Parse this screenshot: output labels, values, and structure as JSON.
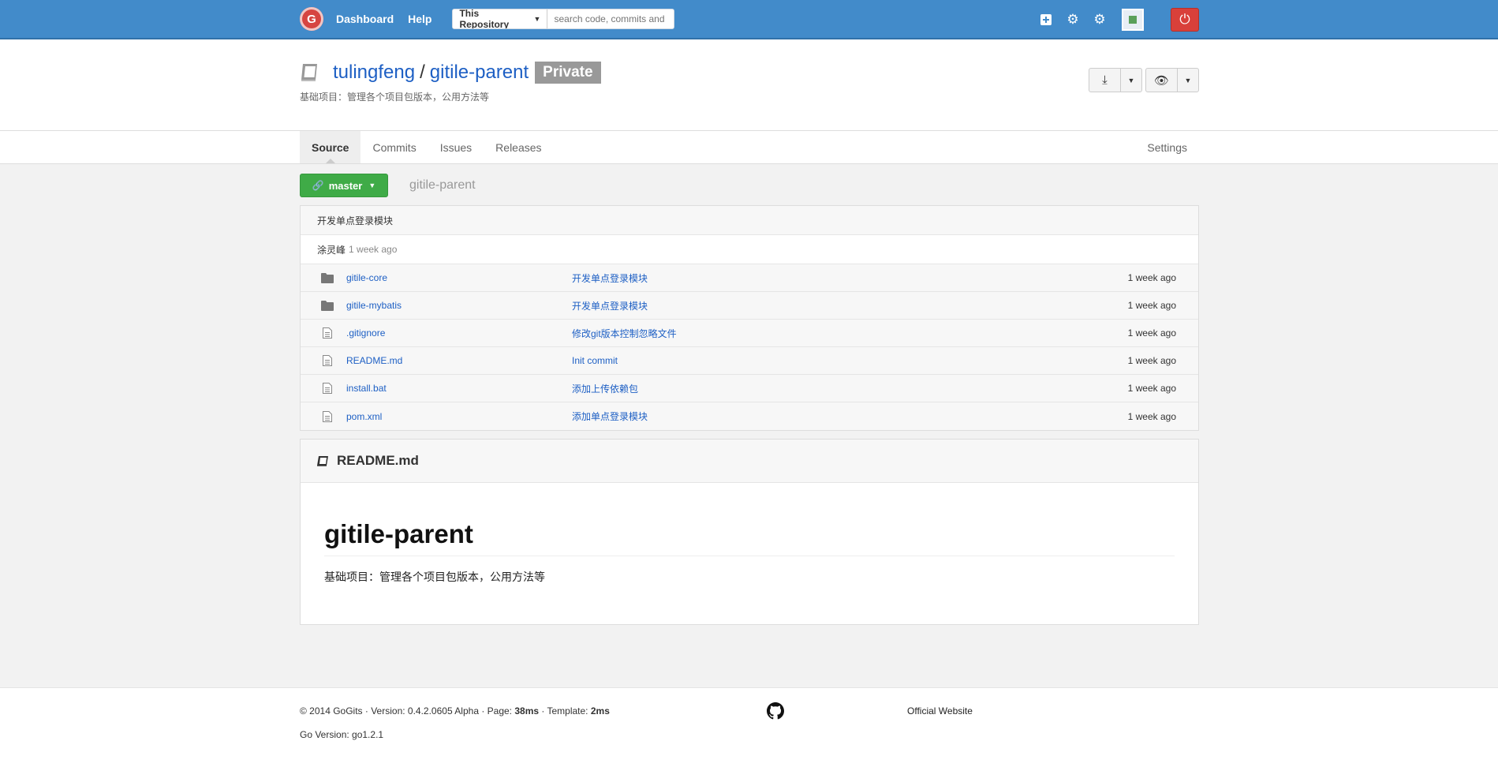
{
  "nav": {
    "logo_text": "G",
    "dashboard": "Dashboard",
    "help": "Help",
    "search_scope": "This Repository",
    "search_placeholder": "search code, commits and issues",
    "icons": [
      "plus-square-icon",
      "gear-icon",
      "gears-icon",
      "avatar",
      "power-icon"
    ]
  },
  "repo": {
    "owner": "tulingfeng",
    "separator": "/",
    "name": "gitile-parent",
    "badge": "Private",
    "description": "基础项目：管理各个项目包版本，公用方法等"
  },
  "tabs": [
    {
      "label": "Source",
      "active": true
    },
    {
      "label": "Commits"
    },
    {
      "label": "Issues"
    },
    {
      "label": "Releases"
    }
  ],
  "settings_tab": "Settings",
  "branch": {
    "label": "master",
    "breadcrumb": "gitile-parent"
  },
  "latest_commit": {
    "message": "开发单点登录模块",
    "author": "涂灵峰",
    "time": "1 week ago"
  },
  "files": [
    {
      "type": "folder",
      "name": "gitile-core",
      "message": "开发单点登录模块",
      "time": "1 week ago"
    },
    {
      "type": "folder",
      "name": "gitile-mybatis",
      "message": "开发单点登录模块",
      "time": "1 week ago"
    },
    {
      "type": "file",
      "name": ".gitignore",
      "message": "修改git版本控制忽略文件",
      "time": "1 week ago"
    },
    {
      "type": "file",
      "name": "README.md",
      "message": "Init commit",
      "time": "1 week ago"
    },
    {
      "type": "file",
      "name": "install.bat",
      "message": "添加上传依赖包",
      "time": "1 week ago"
    },
    {
      "type": "file",
      "name": "pom.xml",
      "message": "添加单点登录模块",
      "time": "1 week ago"
    }
  ],
  "readme": {
    "filename": "README.md",
    "heading": "gitile-parent",
    "body": "基础项目：管理各个项目包版本，公用方法等"
  },
  "footer": {
    "copyright": "© 2014 GoGits · Version: 0.4.2.0605 Alpha · Page: ",
    "page_time": "38ms",
    "template_label": " · Template: ",
    "template_time": "2ms",
    "go_version": "Go Version: go1.2.1",
    "official": "Official Website"
  },
  "colors": {
    "nav_bg": "#428bca",
    "link": "#1d5fc4",
    "branch_btn": "#3fab47",
    "signout": "#d9403a",
    "badge": "#999999"
  }
}
